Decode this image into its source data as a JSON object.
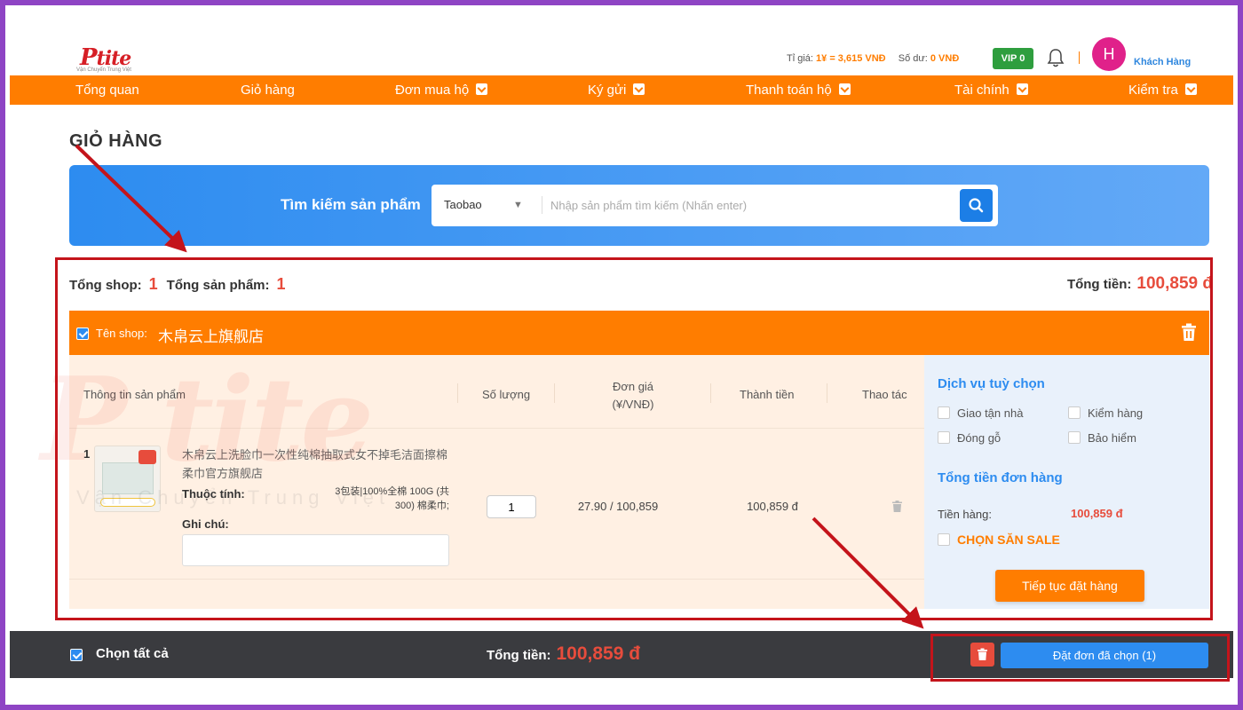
{
  "header": {
    "logo_text": "tite",
    "logo_tagline": "Vận Chuyển Trung Việt",
    "rate_label": "Tỉ giá:",
    "rate_value": "1¥ = 3,615 VNĐ",
    "balance_label": "Số dư:",
    "balance_value": "0 VNĐ",
    "vip_badge": "VIP 0",
    "avatar_initial": "H",
    "user_name": "Khách Hàng"
  },
  "nav": {
    "items": [
      {
        "label": "Tổng quan"
      },
      {
        "label": "Giỏ hàng"
      },
      {
        "label": "Đơn mua hộ"
      },
      {
        "label": "Ký gửi"
      },
      {
        "label": "Thanh toán hộ"
      },
      {
        "label": "Tài chính"
      },
      {
        "label": "Kiểm tra"
      }
    ]
  },
  "page_title": "GIỎ HÀNG",
  "search": {
    "label": "Tìm kiếm sản phẩm",
    "source": "Taobao",
    "placeholder": "Nhập sản phẩm tìm kiếm (Nhấn enter)"
  },
  "summary": {
    "shop_label": "Tổng shop:",
    "shop_count": "1",
    "product_label": "Tổng sản phẩm:",
    "product_count": "1",
    "total_label": "Tổng tiền:",
    "total_value": "100,859 đ"
  },
  "shop": {
    "name_label": "Tên shop:",
    "name": "木帛云上旗舰店"
  },
  "table": {
    "headers": {
      "product": "Thông tin sản phẩm",
      "quantity": "Số lượng",
      "unit_price_line1": "Đơn giá",
      "unit_price_line2": "(¥/VNĐ)",
      "line_total": "Thành tiền",
      "actions": "Thao tác"
    },
    "rows": [
      {
        "index": "1",
        "name": "木帛云上洗脸巾一次性纯棉抽取式女不掉毛洁面擦棉柔巾官方旗舰店",
        "attr_label": "Thuộc tính:",
        "attr_value": "3包装|100%全棉 100G (共300) 棉柔巾;",
        "note_label": "Ghi chú:",
        "quantity": "1",
        "unit_price": "27.90 / 100,859",
        "line_total": "100,859 đ"
      }
    ]
  },
  "services": {
    "title": "Dịch vụ tuỳ chọn",
    "options": [
      "Giao tận nhà",
      "Kiểm hàng",
      "Đóng gỗ",
      "Bảo hiểm"
    ],
    "order_total_title": "Tổng tiền đơn hàng",
    "goods_label": "Tiền hàng:",
    "goods_value": "100,859 đ",
    "sale_label": "CHỌN SĂN SALE",
    "continue_label": "Tiếp tục đặt hàng"
  },
  "bottom": {
    "select_all": "Chọn tất cả",
    "total_label": "Tổng tiền:",
    "total_value": "100,859 đ",
    "order_selected": "Đặt đơn đã chọn (1)"
  },
  "colors": {
    "brand_orange": "#ff7d00",
    "primary_blue": "#2d8cf0",
    "price_red": "#e74c3c",
    "annotation_red": "#c4141b"
  }
}
